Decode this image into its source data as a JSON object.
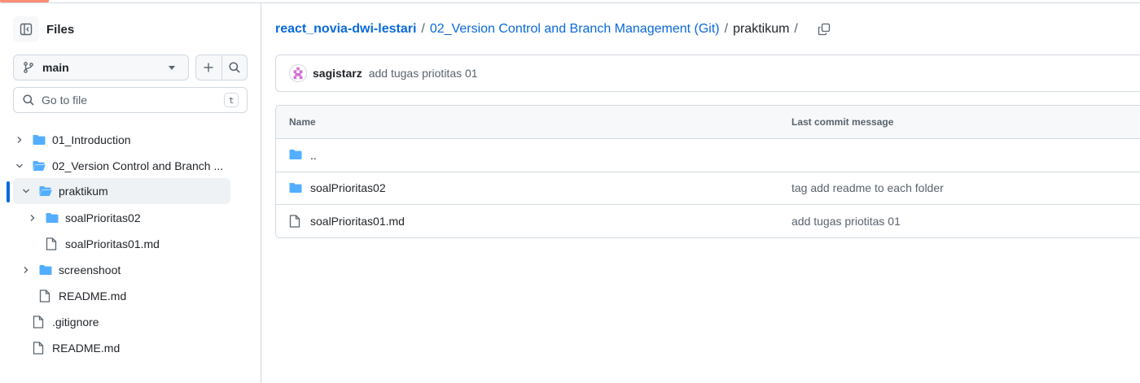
{
  "sidebar": {
    "title": "Files",
    "branch": "main",
    "search_placeholder": "Go to file",
    "search_shortcut": "t",
    "tree": [
      {
        "label": "01_Introduction",
        "type": "folder",
        "expanded": false
      },
      {
        "label": "02_Version Control and Branch ...",
        "type": "folder",
        "expanded": true
      },
      {
        "label": "praktikum",
        "type": "folder",
        "expanded": true,
        "selected": true
      },
      {
        "label": "soalPrioritas02",
        "type": "folder",
        "expanded": false
      },
      {
        "label": "soalPrioritas01.md",
        "type": "file"
      },
      {
        "label": "screenshoot",
        "type": "folder",
        "expanded": false
      },
      {
        "label": "README.md",
        "type": "file"
      },
      {
        "label": ".gitignore",
        "type": "file"
      },
      {
        "label": "README.md",
        "type": "file"
      }
    ]
  },
  "breadcrumb": {
    "repo": "react_novia-dwi-lestari",
    "folder": "02_Version Control and Branch Management (Git)",
    "current": "praktikum",
    "sep": "/"
  },
  "commit": {
    "author": "sagistarz",
    "message": "add tugas priotitas 01"
  },
  "table": {
    "col_name": "Name",
    "col_message": "Last commit message",
    "rows": [
      {
        "name": "..",
        "type": "parent",
        "message": ""
      },
      {
        "name": "soalPrioritas02",
        "type": "folder",
        "message": "tag add readme to each folder"
      },
      {
        "name": "soalPrioritas01.md",
        "type": "file",
        "message": "add tugas priotitas 01"
      }
    ]
  },
  "colors": {
    "link": "#0969da",
    "folder": "#54aeff",
    "accent": "#fd8c73"
  }
}
